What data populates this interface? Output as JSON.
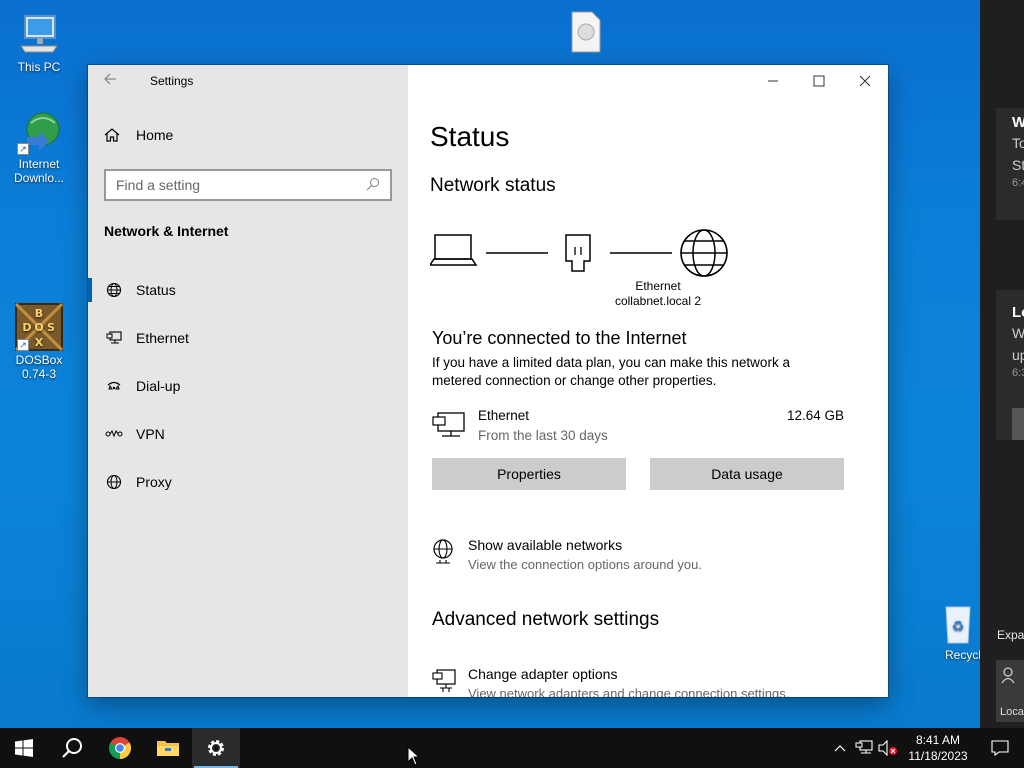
{
  "desktop": {
    "icons": [
      {
        "label": "This PC",
        "icon": "computer-icon"
      },
      {
        "label": "Internet Downlo...",
        "icon": "internet-download-manager-icon"
      },
      {
        "label": "DOSBox 0.74-3",
        "icon": "dosbox-icon"
      },
      {
        "label": "Recycl",
        "icon": "recycle-bin-icon"
      },
      {
        "label": "",
        "icon": "file-icon"
      }
    ]
  },
  "notifications": {
    "cards": [
      {
        "title": "W",
        "body_lines": [
          "To",
          "St"
        ],
        "time": "6:4"
      },
      {
        "title": "Lo",
        "body_lines": [
          "W",
          "up"
        ],
        "time": "6:3"
      }
    ],
    "expand_label": "Expan",
    "quick_tile_label": "Loca"
  },
  "window": {
    "title": "Settings",
    "controls": {
      "minimize": "minimize-icon",
      "maximize": "maximize-icon",
      "close": "close-icon"
    }
  },
  "sidebar": {
    "home_label": "Home",
    "search_placeholder": "Find a setting",
    "section_title": "Network & Internet",
    "items": [
      {
        "label": "Status",
        "icon": "status-globe-icon",
        "selected": true
      },
      {
        "label": "Ethernet",
        "icon": "ethernet-icon",
        "selected": false
      },
      {
        "label": "Dial-up",
        "icon": "dialup-icon",
        "selected": false
      },
      {
        "label": "VPN",
        "icon": "vpn-icon",
        "selected": false
      },
      {
        "label": "Proxy",
        "icon": "proxy-globe-icon",
        "selected": false
      }
    ]
  },
  "content": {
    "page_title": "Status",
    "network_status_heading": "Network status",
    "diagram": {
      "connection_name": "Ethernet",
      "network_name": "collabnet.local 2"
    },
    "connected_heading": "You’re connected to the Internet",
    "connected_desc": "If you have a limited data plan, you can make this network a metered connection or change other properties.",
    "usage": {
      "name": "Ethernet",
      "sub": "From the last 30 days",
      "amount": "12.64 GB"
    },
    "buttons": {
      "properties": "Properties",
      "data_usage": "Data usage"
    },
    "show_networks": {
      "title": "Show available networks",
      "sub": "View the connection options around you."
    },
    "advanced_heading": "Advanced network settings",
    "adapter_options": {
      "title": "Change adapter options",
      "sub": "View network adapters and change connection settings."
    }
  },
  "taskbar": {
    "pinned": [
      "start-icon",
      "search-icon",
      "chrome-icon",
      "file-explorer-icon",
      "settings-gear-icon"
    ],
    "clock_time": "8:41 AM",
    "clock_date": "11/18/2023"
  },
  "colors": {
    "accent": "#0063b1",
    "desktop_bg": "#0b7fd8",
    "taskbar_bg": "#101010",
    "sidebar_bg": "#e6e6e6"
  }
}
